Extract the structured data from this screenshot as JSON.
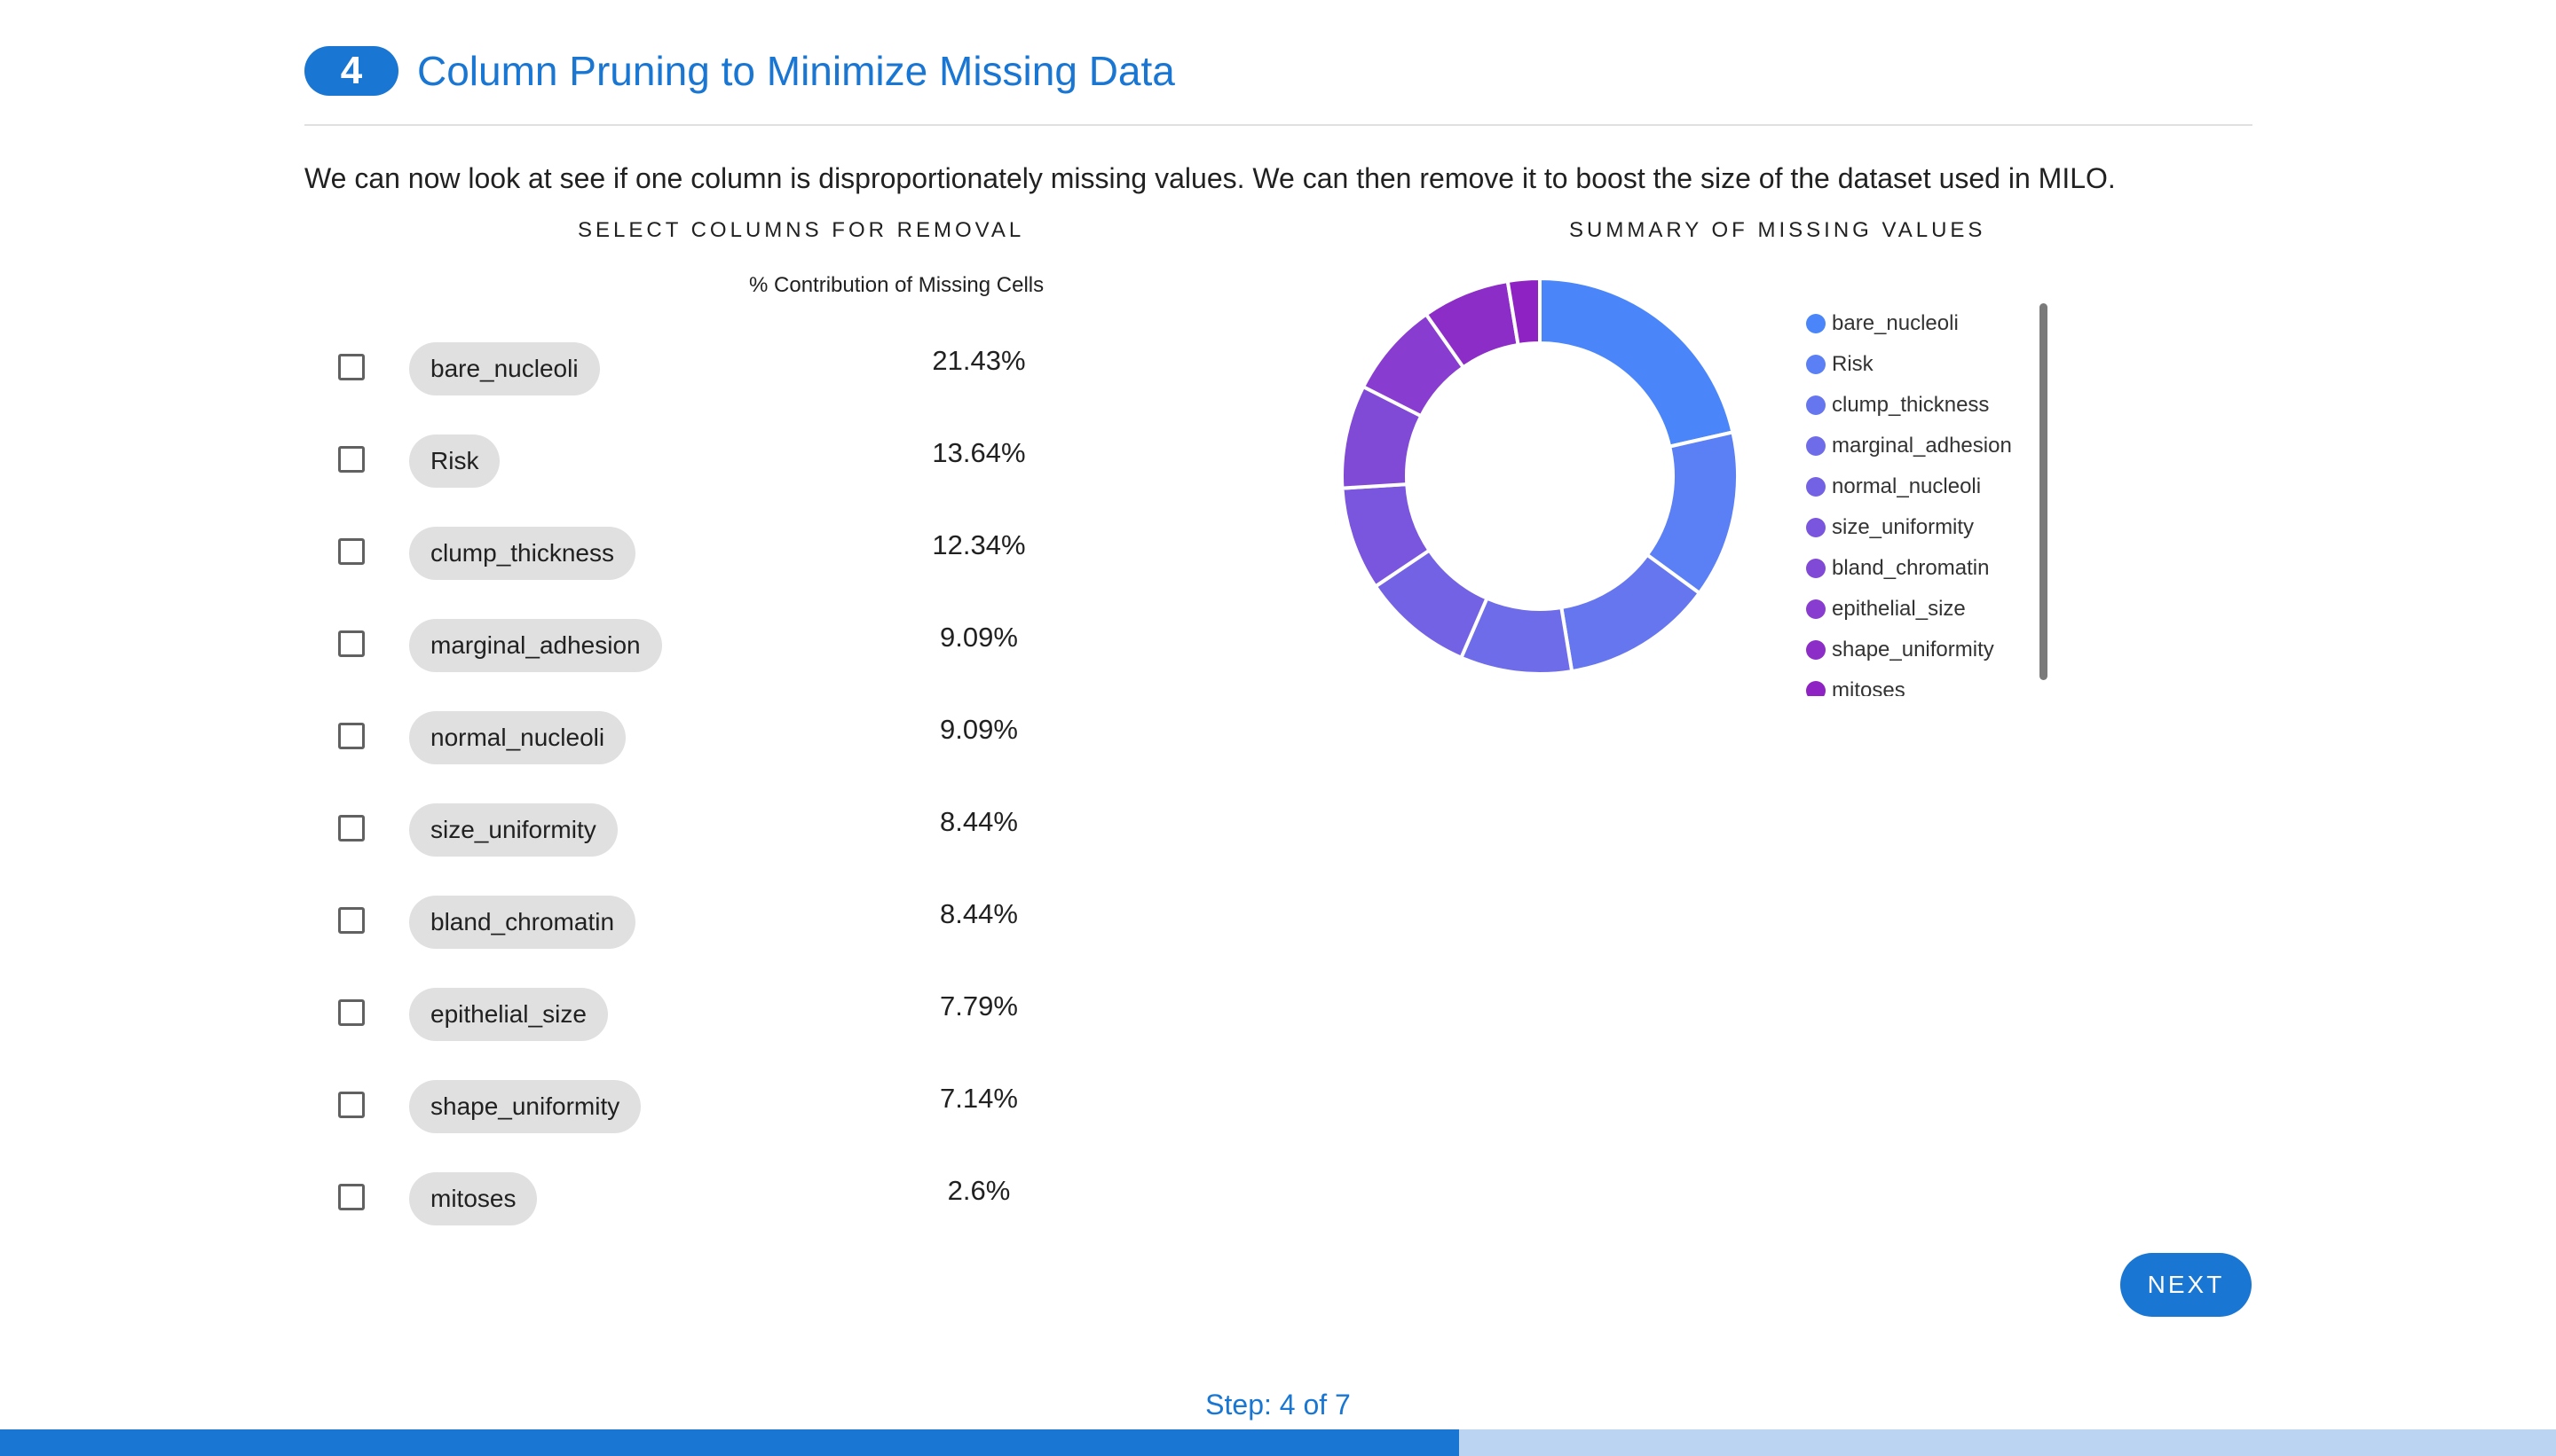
{
  "step_badge": "4",
  "page_title": "Column Pruning to Minimize Missing Data",
  "intro_text": "We can now look at see if one column is disproportionately missing values. We can then remove it to boost the size of the dataset used in MILO.",
  "left_section_title": "SELECT COLUMNS FOR REMOVAL",
  "right_section_title": "SUMMARY OF MISSING VALUES",
  "column_header": "% Contribution of Missing Cells",
  "rows": [
    {
      "name": "bare_nucleoli",
      "pct": "21.43%",
      "checked": false
    },
    {
      "name": "Risk",
      "pct": "13.64%",
      "checked": false
    },
    {
      "name": "clump_thickness",
      "pct": "12.34%",
      "checked": false
    },
    {
      "name": "marginal_adhesion",
      "pct": "9.09%",
      "checked": false
    },
    {
      "name": "normal_nucleoli",
      "pct": "9.09%",
      "checked": false
    },
    {
      "name": "size_uniformity",
      "pct": "8.44%",
      "checked": false
    },
    {
      "name": "bland_chromatin",
      "pct": "8.44%",
      "checked": false
    },
    {
      "name": "epithelial_size",
      "pct": "7.79%",
      "checked": false
    },
    {
      "name": "shape_uniformity",
      "pct": "7.14%",
      "checked": false
    },
    {
      "name": "mitoses",
      "pct": "2.6%",
      "checked": false
    }
  ],
  "chart_data": {
    "type": "pie",
    "variant": "donut",
    "categories": [
      "bare_nucleoli",
      "Risk",
      "clump_thickness",
      "marginal_adhesion",
      "normal_nucleoli",
      "size_uniformity",
      "bland_chromatin",
      "epithelial_size",
      "shape_uniformity",
      "mitoses"
    ],
    "values": [
      21.43,
      13.64,
      12.34,
      9.09,
      9.09,
      8.44,
      8.44,
      7.79,
      7.14,
      2.6
    ],
    "colors": [
      "#4a86fa",
      "#5b7ff5",
      "#6676ef",
      "#6f6cea",
      "#7462e5",
      "#7a55dd",
      "#8049d6",
      "#883dd0",
      "#8c2dc8",
      "#8f22c2"
    ],
    "legend_position": "right",
    "title": ""
  },
  "next_button": "NEXT",
  "step_text": "Step: 4 of 7",
  "progress": 0.571
}
